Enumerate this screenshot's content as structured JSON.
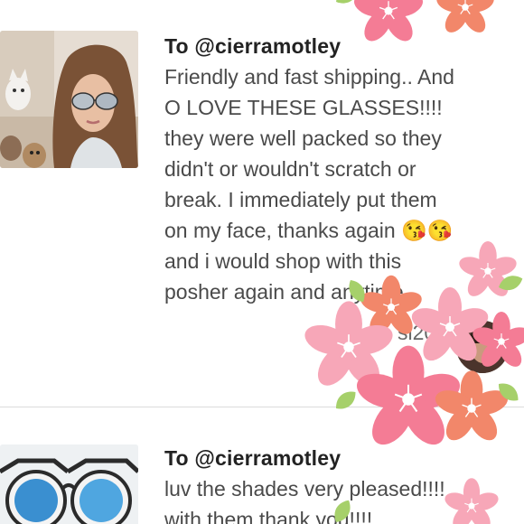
{
  "reviews": [
    {
      "to": "To @cierramotley",
      "lines": [
        "Friendly and fast shipping.. And",
        "O LOVE THESE GLASSES!!!!",
        "they were well packed so they",
        "didn't or wouldn't scratch or",
        "break. I immediately put them",
        "on my face, thanks again 😘😘",
        "and i would shop with this",
        "posher again and anytime"
      ],
      "sender_partial": "sl20",
      "thumb_alt": "woman with mirrored sunglasses and dogs"
    },
    {
      "to": "To @cierramotley",
      "lines": [
        "luv the shades very pleased!!!!",
        "with them thank you!!!!"
      ],
      "thumb_alt": "round cat-eye sunglasses with blue lenses"
    }
  ],
  "colors": {
    "flower_pink": "#f47c95",
    "flower_light_pink": "#f7a7b8",
    "flower_coral": "#f2876a",
    "leaf_green": "#a6d06a"
  }
}
